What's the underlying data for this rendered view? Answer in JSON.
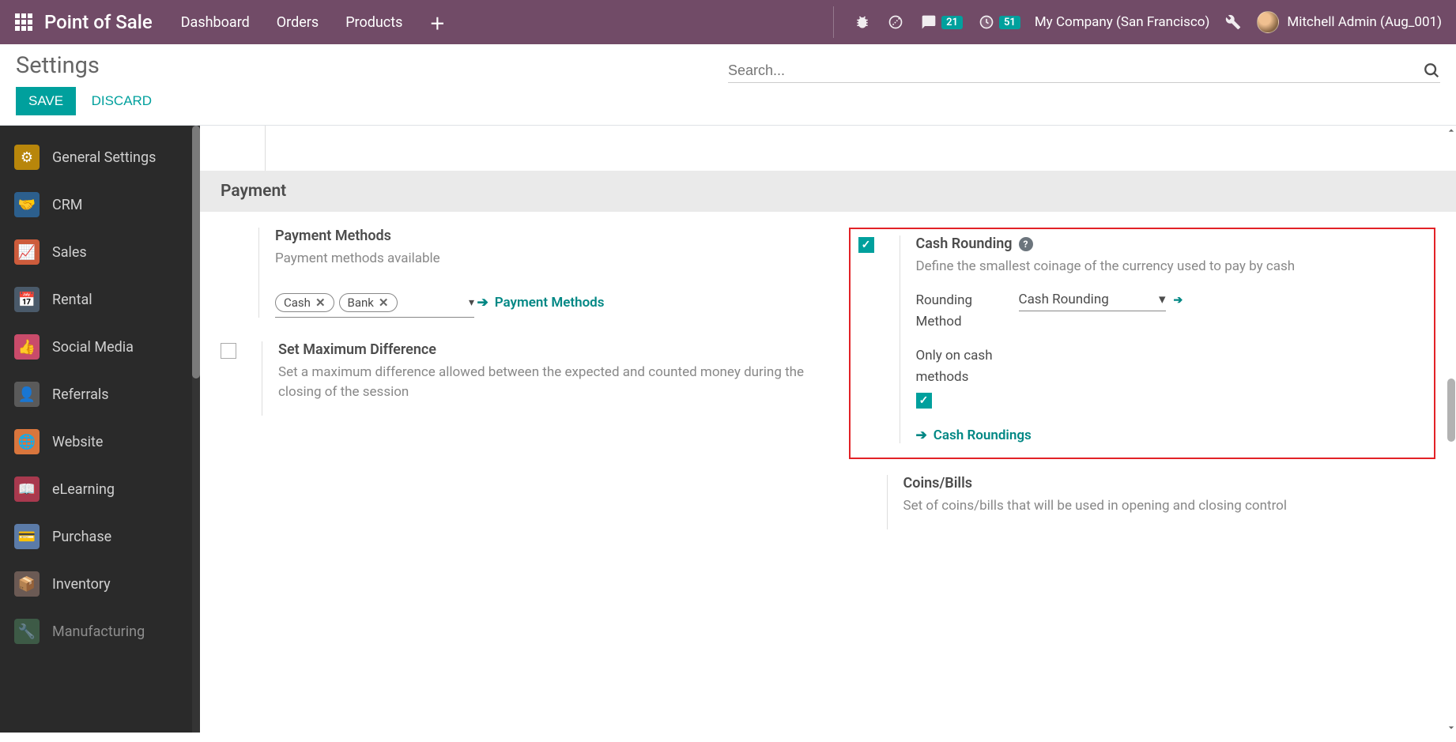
{
  "topnav": {
    "brand": "Point of Sale",
    "menu": [
      "Dashboard",
      "Orders",
      "Products"
    ],
    "messages_badge": "21",
    "activities_badge": "51",
    "company": "My Company (San Francisco)",
    "user": "Mitchell Admin (Aug_001)"
  },
  "control_panel": {
    "title": "Settings",
    "save": "SAVE",
    "discard": "DISCARD",
    "search_placeholder": "Search..."
  },
  "sidebar": {
    "items": [
      {
        "label": "General Settings"
      },
      {
        "label": "CRM"
      },
      {
        "label": "Sales"
      },
      {
        "label": "Rental"
      },
      {
        "label": "Social Media"
      },
      {
        "label": "Referrals"
      },
      {
        "label": "Website"
      },
      {
        "label": "eLearning"
      },
      {
        "label": "Purchase"
      },
      {
        "label": "Inventory"
      },
      {
        "label": "Manufacturing"
      }
    ]
  },
  "main": {
    "section_title": "Payment",
    "payment_methods": {
      "title": "Payment Methods",
      "desc": "Payment methods available",
      "tags": [
        "Cash",
        "Bank"
      ],
      "link": "Payment Methods"
    },
    "cash_rounding": {
      "title": "Cash Rounding",
      "desc": "Define the smallest coinage of the currency used to pay by cash",
      "rounding_method_label": "Rounding Method",
      "rounding_method_value": "Cash Rounding",
      "only_cash_label": "Only on cash methods",
      "link": "Cash Roundings"
    },
    "max_diff": {
      "title": "Set Maximum Difference",
      "desc": "Set a maximum difference allowed between the expected and counted money during the closing of the session"
    },
    "coins_bills": {
      "title": "Coins/Bills",
      "desc": "Set of coins/bills that will be used in opening and closing control"
    }
  }
}
